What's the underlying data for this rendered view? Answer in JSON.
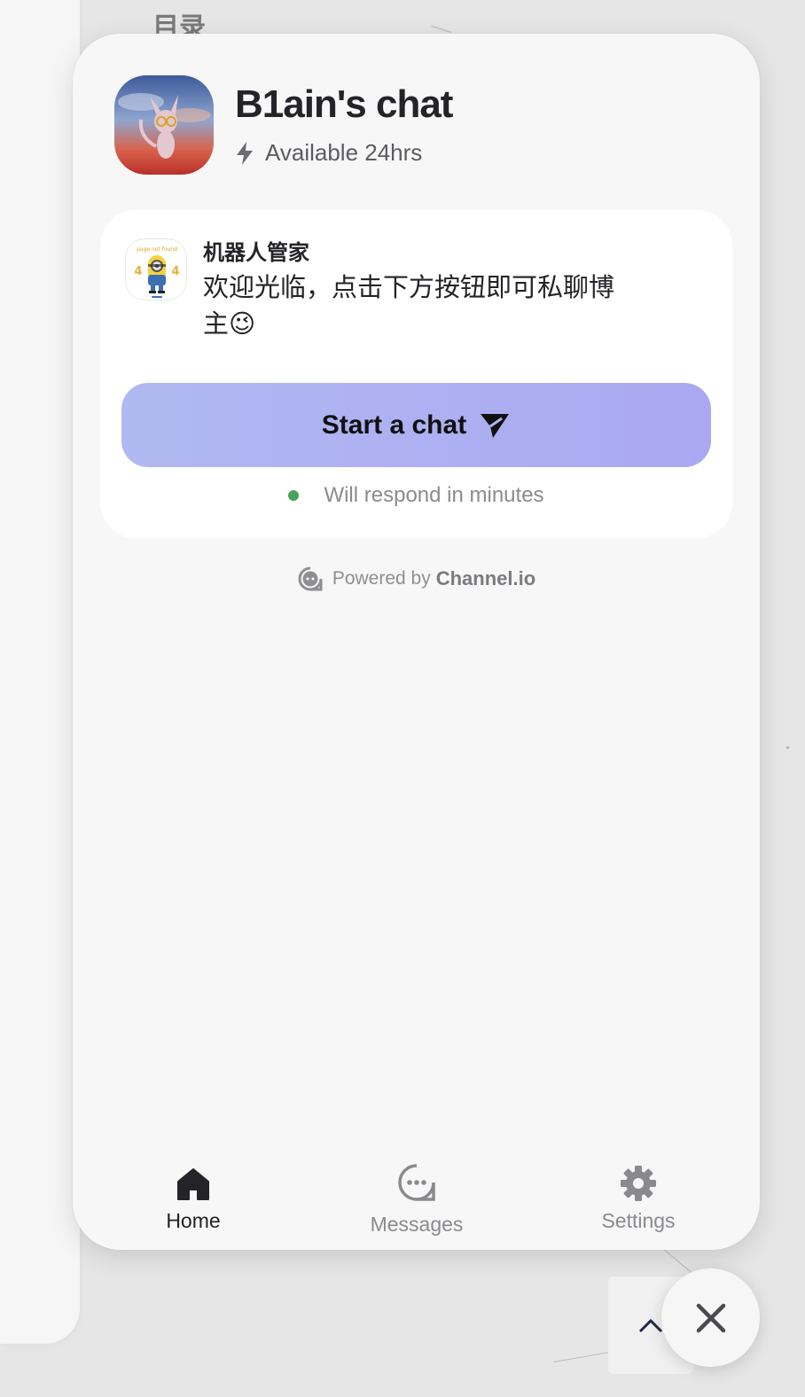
{
  "background": {
    "toc_title": "目录"
  },
  "header": {
    "channel_name": "B1ain's chat",
    "availability": "Available 24hrs"
  },
  "message_card": {
    "bot_name": "机器人管家",
    "message": "欢迎光临，点击下方按钮即可私聊博主😉",
    "start_button_label": "Start a chat",
    "response_status": "Will respond in minutes"
  },
  "footer": {
    "powered_prefix": "Powered by",
    "powered_brand": "Channel.io"
  },
  "nav": {
    "items": [
      {
        "label": "Home",
        "icon": "home-icon",
        "active": true
      },
      {
        "label": "Messages",
        "icon": "chat-bubble-icon",
        "active": false
      },
      {
        "label": "Settings",
        "icon": "gear-icon",
        "active": false
      }
    ]
  },
  "colors": {
    "accent_gradient_start": "#b0b9f2",
    "accent_gradient_end": "#aaa8f1",
    "online_dot": "#4aa35b"
  }
}
